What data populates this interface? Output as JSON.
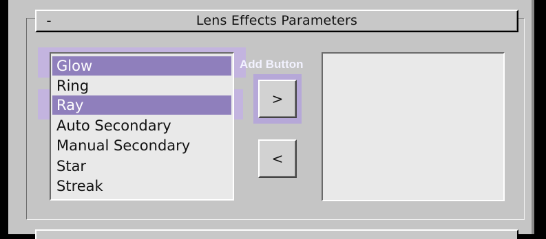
{
  "rollout": {
    "collapse_symbol": "-",
    "title": "Lens Effects Parameters"
  },
  "effects_list": {
    "items": [
      {
        "label": "Glow",
        "selected": true
      },
      {
        "label": "Ring",
        "selected": false
      },
      {
        "label": "Ray",
        "selected": true
      },
      {
        "label": "Auto Secondary",
        "selected": false
      },
      {
        "label": "Manual Secondary",
        "selected": false
      },
      {
        "label": "Star",
        "selected": false
      },
      {
        "label": "Streak",
        "selected": false
      }
    ]
  },
  "buttons": {
    "add_annotation": "Add Button",
    "add_label": ">",
    "remove_label": "<"
  },
  "active_effects_list": {
    "items": []
  },
  "colors": {
    "selection": "#8f7fbc",
    "highlight_halo": "#c3b4df",
    "panel": "#c5c5c5"
  }
}
